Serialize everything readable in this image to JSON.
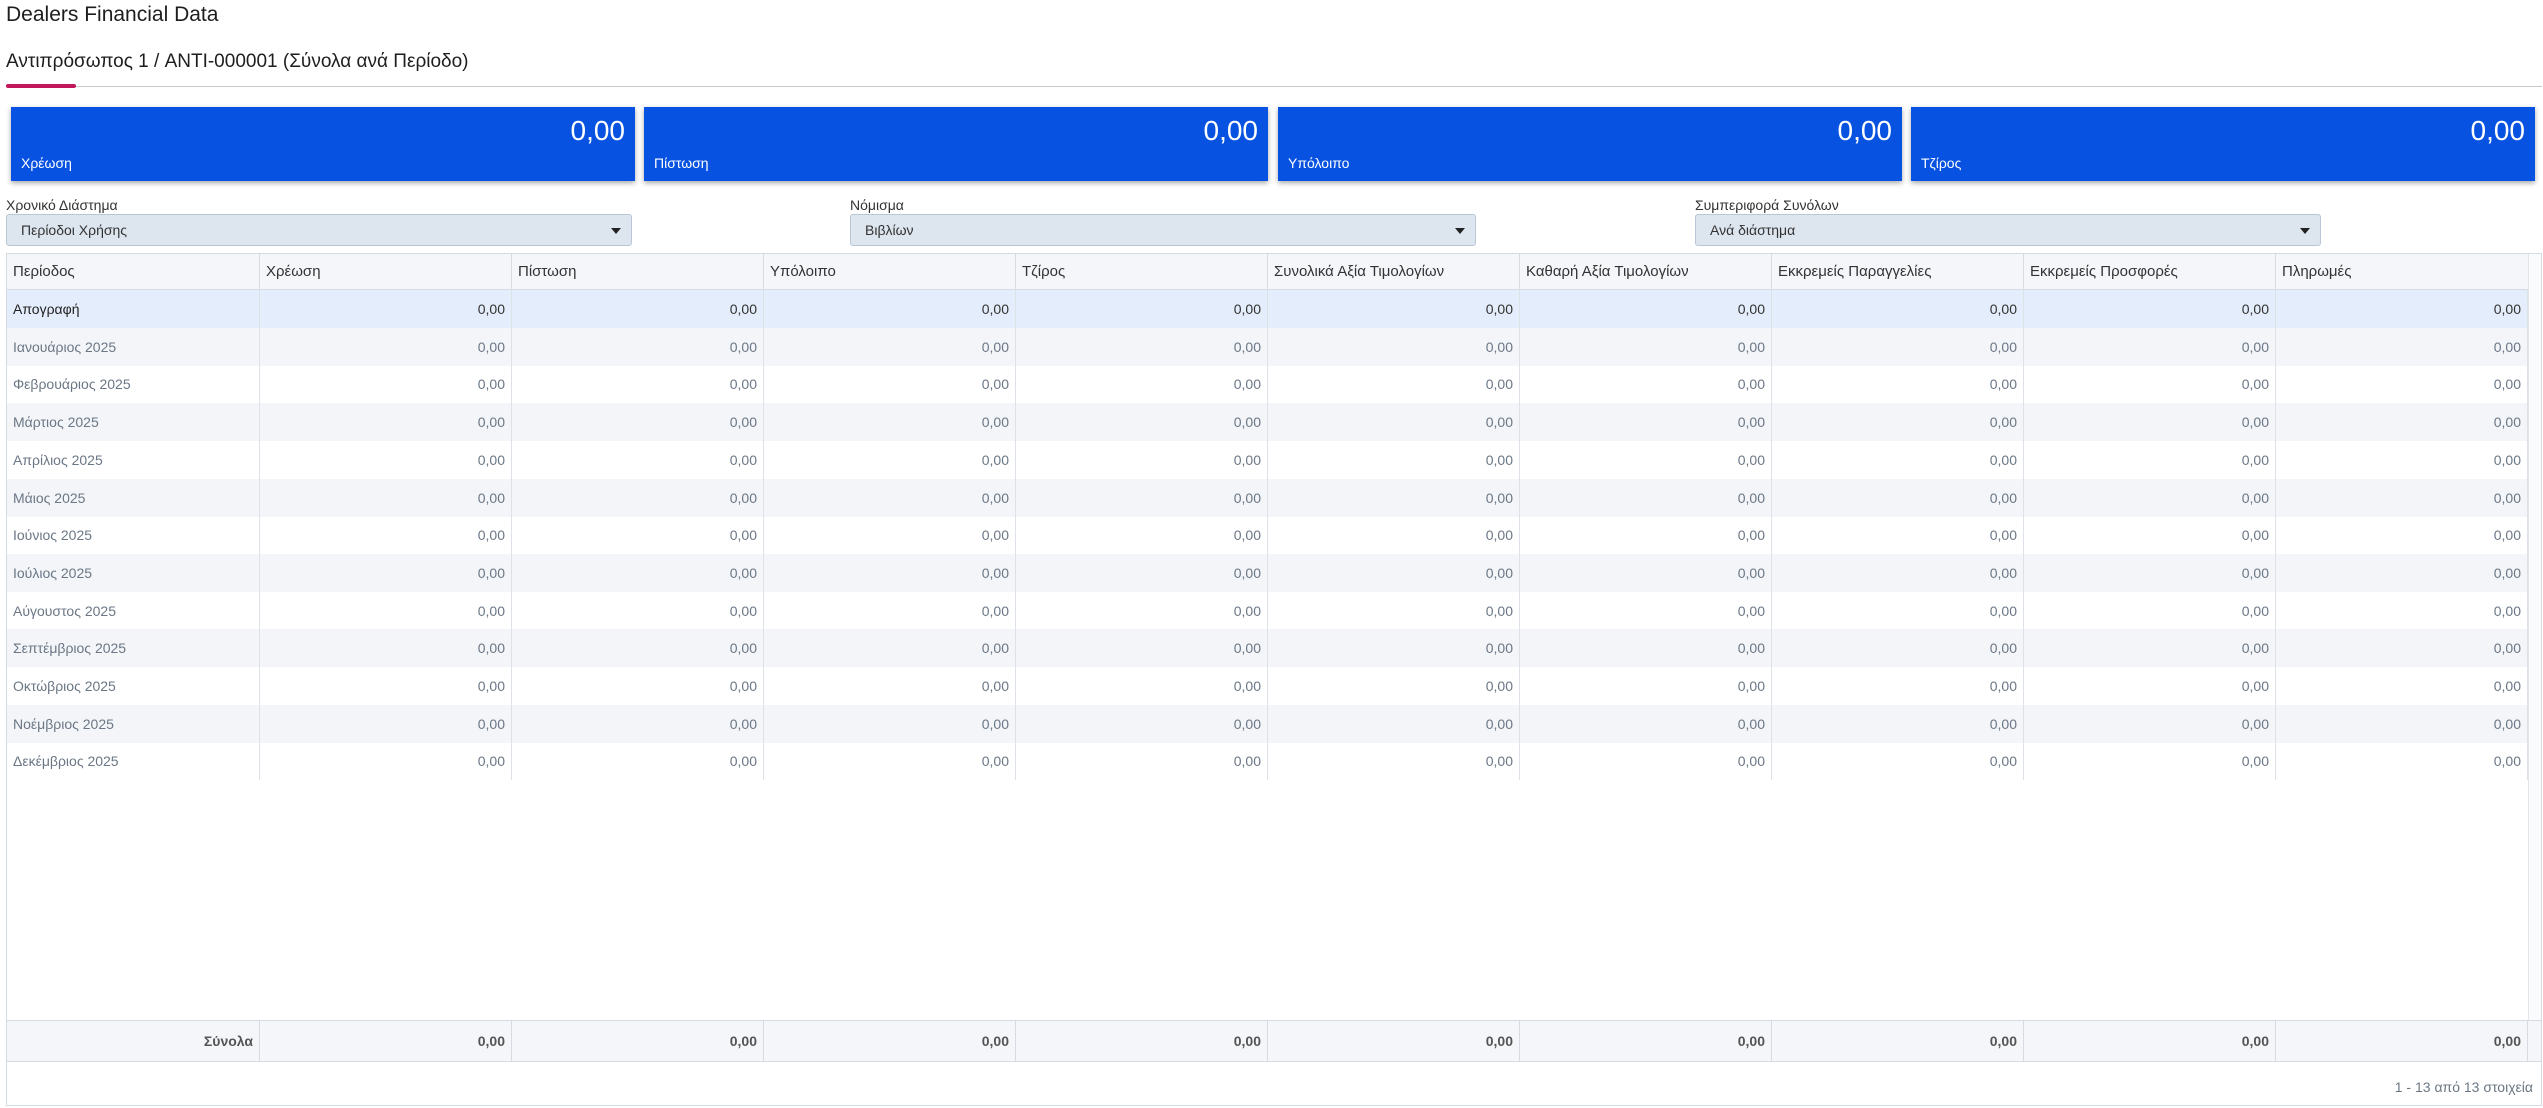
{
  "page": {
    "title": "Dealers Financial Data",
    "subtitle": "Αντιπρόσωπος 1 / ANTI-000001 (Σύνολα ανά Περίοδο)"
  },
  "colors": {
    "card_bg": "#0752e0",
    "accent": "#c2185b"
  },
  "cards": [
    {
      "label": "Χρέωση",
      "value": "0,00"
    },
    {
      "label": "Πίστωση",
      "value": "0,00"
    },
    {
      "label": "Υπόλοιπο",
      "value": "0,00"
    },
    {
      "label": "Τζίρος",
      "value": "0,00"
    }
  ],
  "filters": [
    {
      "label": "Χρονικό Διάστημα",
      "value": "Περίοδοι Χρήσης"
    },
    {
      "label": "Νόμισμα",
      "value": "Βιβλίων"
    },
    {
      "label": "Συμπεριφορά Συνόλων",
      "value": "Ανά διάστημα"
    }
  ],
  "grid": {
    "columns": [
      "Περίοδος",
      "Χρέωση",
      "Πίστωση",
      "Υπόλοιπο",
      "Τζίρος",
      "Συνολικά Αξία Τιμολογίων",
      "Καθαρή Αξία Τιμολογίων",
      "Εκκρεμείς Παραγγελίες",
      "Εκκρεμείς Προσφορές",
      "Πληρωμές"
    ],
    "rows": [
      {
        "period": "Απογραφή",
        "values": [
          "0,00",
          "0,00",
          "0,00",
          "0,00",
          "0,00",
          "0,00",
          "0,00",
          "0,00",
          "0,00"
        ]
      },
      {
        "period": "Ιανουάριος 2025",
        "values": [
          "0,00",
          "0,00",
          "0,00",
          "0,00",
          "0,00",
          "0,00",
          "0,00",
          "0,00",
          "0,00"
        ]
      },
      {
        "period": "Φεβρουάριος 2025",
        "values": [
          "0,00",
          "0,00",
          "0,00",
          "0,00",
          "0,00",
          "0,00",
          "0,00",
          "0,00",
          "0,00"
        ]
      },
      {
        "period": "Μάρτιος 2025",
        "values": [
          "0,00",
          "0,00",
          "0,00",
          "0,00",
          "0,00",
          "0,00",
          "0,00",
          "0,00",
          "0,00"
        ]
      },
      {
        "period": "Απρίλιος 2025",
        "values": [
          "0,00",
          "0,00",
          "0,00",
          "0,00",
          "0,00",
          "0,00",
          "0,00",
          "0,00",
          "0,00"
        ]
      },
      {
        "period": "Μάιος 2025",
        "values": [
          "0,00",
          "0,00",
          "0,00",
          "0,00",
          "0,00",
          "0,00",
          "0,00",
          "0,00",
          "0,00"
        ]
      },
      {
        "period": "Ιούνιος 2025",
        "values": [
          "0,00",
          "0,00",
          "0,00",
          "0,00",
          "0,00",
          "0,00",
          "0,00",
          "0,00",
          "0,00"
        ]
      },
      {
        "period": "Ιούλιος 2025",
        "values": [
          "0,00",
          "0,00",
          "0,00",
          "0,00",
          "0,00",
          "0,00",
          "0,00",
          "0,00",
          "0,00"
        ]
      },
      {
        "period": "Αύγουστος 2025",
        "values": [
          "0,00",
          "0,00",
          "0,00",
          "0,00",
          "0,00",
          "0,00",
          "0,00",
          "0,00",
          "0,00"
        ]
      },
      {
        "period": "Σεπτέμβριος 2025",
        "values": [
          "0,00",
          "0,00",
          "0,00",
          "0,00",
          "0,00",
          "0,00",
          "0,00",
          "0,00",
          "0,00"
        ]
      },
      {
        "period": "Οκτώβριος 2025",
        "values": [
          "0,00",
          "0,00",
          "0,00",
          "0,00",
          "0,00",
          "0,00",
          "0,00",
          "0,00",
          "0,00"
        ]
      },
      {
        "period": "Νοέμβριος 2025",
        "values": [
          "0,00",
          "0,00",
          "0,00",
          "0,00",
          "0,00",
          "0,00",
          "0,00",
          "0,00",
          "0,00"
        ]
      },
      {
        "period": "Δεκέμβριος 2025",
        "values": [
          "0,00",
          "0,00",
          "0,00",
          "0,00",
          "0,00",
          "0,00",
          "0,00",
          "0,00",
          "0,00"
        ]
      }
    ],
    "totals_label": "Σύνολα",
    "totals": [
      "0,00",
      "0,00",
      "0,00",
      "0,00",
      "0,00",
      "0,00",
      "0,00",
      "0,00",
      "0,00"
    ],
    "pager_text": "1 - 13 από 13 στοιχεία"
  }
}
